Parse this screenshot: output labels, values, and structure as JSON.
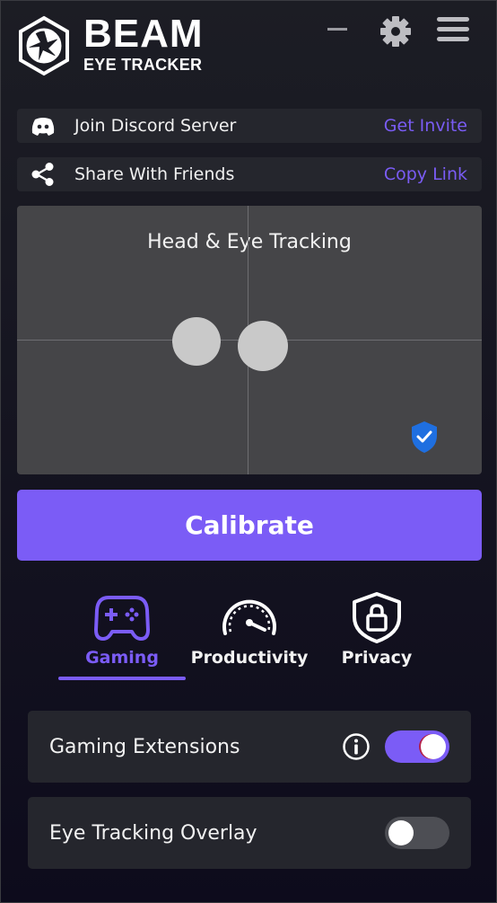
{
  "header": {
    "brand_name": "BEAM",
    "brand_sub": "EYE TRACKER"
  },
  "links": [
    {
      "icon": "discord-icon",
      "label": "Join Discord Server",
      "action": "Get Invite"
    },
    {
      "icon": "share-icon",
      "label": "Share With Friends",
      "action": "Copy Link"
    }
  ],
  "tracking": {
    "title": "Head & Eye Tracking",
    "status_icon": "shield-check-icon"
  },
  "calibrate_label": "Calibrate",
  "tabs": [
    {
      "label": "Gaming",
      "icon": "gamepad-icon",
      "active": true
    },
    {
      "label": "Productivity",
      "icon": "speedometer-icon",
      "active": false
    },
    {
      "label": "Privacy",
      "icon": "shield-lock-icon",
      "active": false
    }
  ],
  "settings": [
    {
      "label": "Gaming Extensions",
      "has_info": true,
      "enabled": true
    },
    {
      "label": "Eye Tracking Overlay",
      "has_info": false,
      "enabled": false
    }
  ],
  "colors": {
    "accent": "#7b5cf6",
    "card_bg": "#25262d",
    "panel_bg": "#454548",
    "shield_blue": "#1f6fe0"
  }
}
